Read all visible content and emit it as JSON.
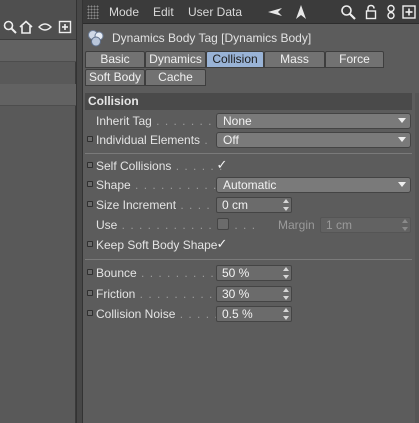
{
  "menubar": {
    "items": [
      "Mode",
      "Edit",
      "User Data"
    ],
    "icons": [
      "back-arrow-icon",
      "up-arrow-icon",
      "search-icon",
      "lock-icon",
      "link-icon",
      "new-panel-icon"
    ]
  },
  "left_panel": {
    "icons": [
      "search-icon",
      "home-icon",
      "eye-icon",
      "new-panel-icon"
    ]
  },
  "tag": {
    "title": "Dynamics Body Tag [Dynamics Body]"
  },
  "tabs": [
    {
      "label": "Basic",
      "active": false
    },
    {
      "label": "Dynamics",
      "active": false
    },
    {
      "label": "Collision",
      "active": true
    },
    {
      "label": "Mass",
      "active": false
    },
    {
      "label": "Force",
      "active": false
    },
    {
      "label": "Soft Body",
      "active": false
    },
    {
      "label": "Cache",
      "active": false
    }
  ],
  "section": {
    "title": "Collision",
    "inherit_tag": {
      "label": "Inherit Tag",
      "dots": " . . . . . . . . .",
      "value": "None"
    },
    "individual_elements": {
      "label": "Individual Elements",
      "dots": " .",
      "value": "Off"
    },
    "self_collisions": {
      "label": "Self Collisions",
      "dots": " . . . . . .",
      "checked": true
    },
    "shape": {
      "label": "Shape",
      "dots": " . . . . . . . . . . . . . .",
      "value": "Automatic"
    },
    "size_increment": {
      "label": "Size Increment",
      "dots": " . . . . . .",
      "value": "0 cm"
    },
    "use": {
      "label": "Use",
      "dots": " . . . . . . . . . . . . . . . .",
      "checked": false
    },
    "margin": {
      "label": "Margin",
      "value": "1 cm"
    },
    "keep_soft_body_shape": {
      "label": "Keep Soft Body Shape",
      "checked": true
    },
    "bounce": {
      "label": "Bounce",
      "dots": " . . . . . . . . . . . . .",
      "value": "50 %"
    },
    "friction": {
      "label": "Friction",
      "dots": " . . . . . . . . . . . . .",
      "value": "30 %"
    },
    "collision_noise": {
      "label": "Collision Noise",
      "dots": " . . . . . .",
      "value": "0.5 %"
    }
  },
  "colors": {
    "active_tab": "#99b3d6",
    "background": "#5c5c5c",
    "menubar": "#3b3b3b"
  }
}
